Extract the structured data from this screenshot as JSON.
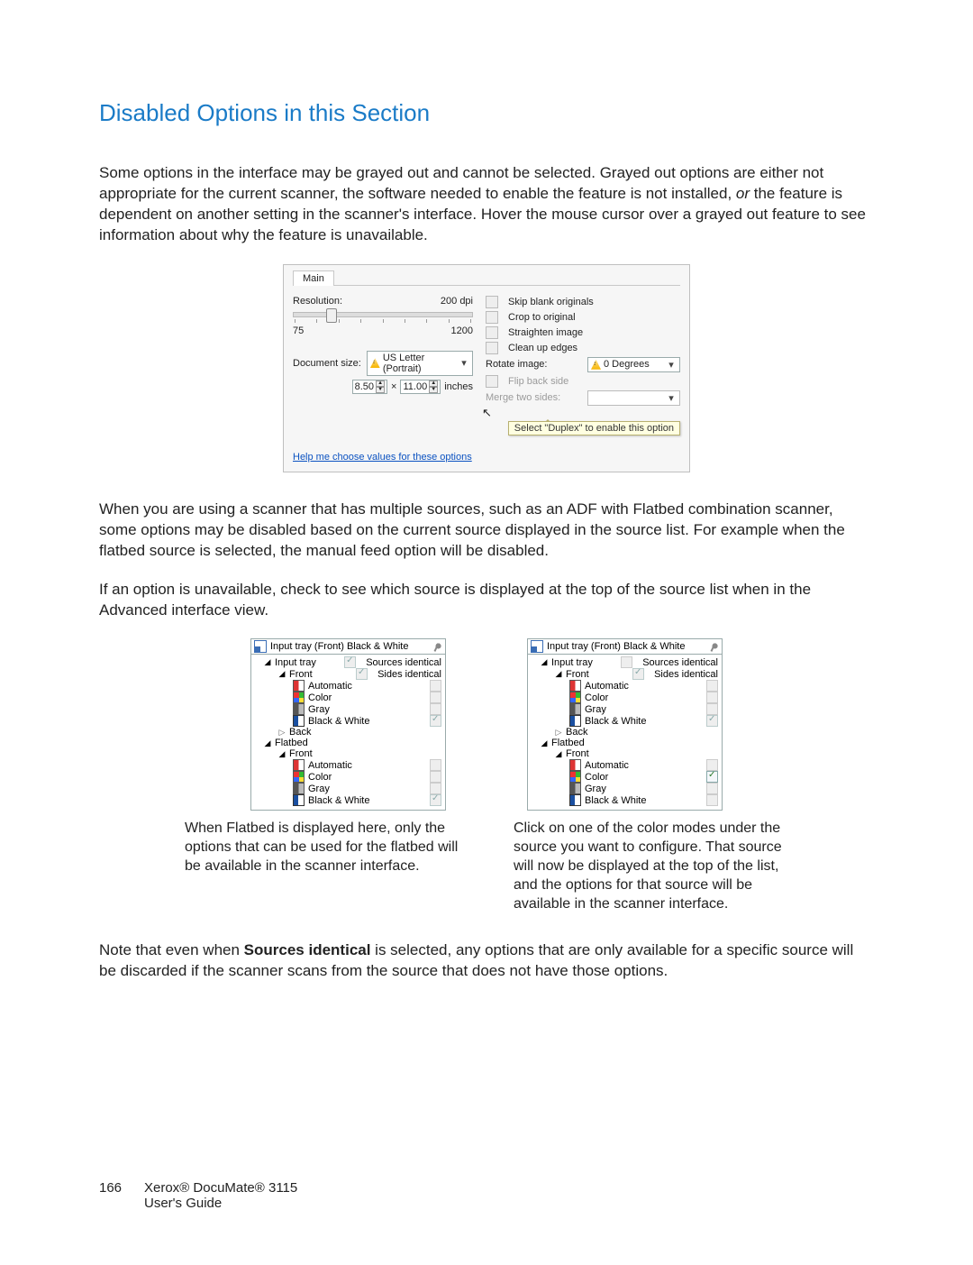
{
  "heading": "Disabled Options in this Section",
  "para1_a": "Some options in the interface may be grayed out and cannot be selected. Grayed out options are either not appropriate for the current scanner, the software needed to enable the feature is not installed, ",
  "para1_or": "or",
  "para1_b": " the feature is dependent on another setting in the scanner's interface. Hover the mouse cursor over a grayed out feature to see information about why the feature is unavailable.",
  "para2": "When you are using a scanner that has multiple sources, such as an ADF with Flatbed combination scanner, some options may be disabled based on the current source displayed in the source list. For example when the flatbed source is selected, the manual feed option will be disabled.",
  "para3": "If an option is unavailable, check to see which source is displayed at the top of the source list when in the Advanced interface view.",
  "para4_a": "Note that even when ",
  "para4_bold": "Sources identical",
  "para4_b": " is selected, any options that are only available for a specific source will be discarded if the scanner scans from the source that does not have those options.",
  "shot1": {
    "tab": "Main",
    "resolution_label": "Resolution:",
    "resolution_value": "200 dpi",
    "slider_min": "75",
    "slider_max": "1200",
    "doc_size_label": "Document size:",
    "doc_size_value": "US Letter (Portrait)",
    "width": "8.50",
    "height": "11.00",
    "units": "inches",
    "times": "×",
    "opts": {
      "skip": "Skip blank originals",
      "crop": "Crop to original",
      "straighten": "Straighten image",
      "clean": "Clean up edges",
      "rotate_label": "Rotate image:",
      "rotate_value": "0 Degrees",
      "flip": "Flip back side",
      "merge": "Merge two sides:"
    },
    "tooltip": "Select \"Duplex\" to enable this option",
    "help_link": "Help me choose values for these options"
  },
  "tree_common": {
    "sources_identical": "Sources identical",
    "sides_identical": "Sides identical",
    "input_tray": "Input tray",
    "front": "Front",
    "back": "Back",
    "flatbed": "Flatbed",
    "automatic": "Automatic",
    "color": "Color",
    "gray": "Gray",
    "bw": "Black & White"
  },
  "tree_left": {
    "header": "Input tray (Front) Black & White",
    "sources_identical_checked": true,
    "sides_identical_checked": true,
    "flatbed_color_checked": false
  },
  "tree_right": {
    "header": "Input tray (Front) Black & White",
    "sources_identical_checked": false,
    "sides_identical_checked": true,
    "flatbed_color_checked": true
  },
  "caption_left": "When Flatbed is displayed here, only the options that can be used for the flatbed will be available in the scanner interface.",
  "caption_right": "Click on one of the color modes under the source you want to configure.  That source will now be displayed at the top of the list, and the options for that source will be available in the scanner interface.",
  "footer": {
    "page": "166",
    "line1": "Xerox® DocuMate® 3115",
    "line2": "User's Guide"
  }
}
